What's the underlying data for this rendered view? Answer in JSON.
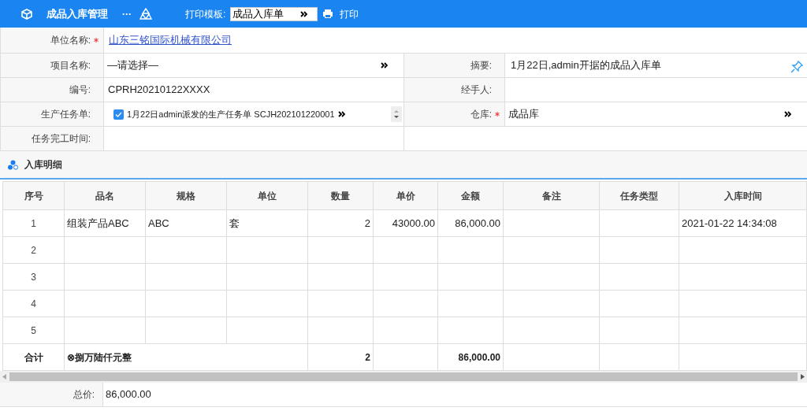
{
  "toolbar": {
    "title": "成品入库管理",
    "more": "···",
    "print_template_label": "打印模板:",
    "print_template_value": "成品入库单",
    "print_button": "打印"
  },
  "form": {
    "company": {
      "label": "单位名称:",
      "required": true,
      "value": "山东三铭国际机械有限公司"
    },
    "rows": [
      {
        "left": {
          "label": "项目名称:",
          "required": false,
          "value": "—请选择—",
          "kind": "select"
        },
        "right": {
          "label": "摘要:",
          "required": false,
          "value": "1月22日,admin开据的成品入库单",
          "kind": "pin"
        }
      },
      {
        "left": {
          "label": "编号:",
          "required": false,
          "value": "CPRH20210122XXXX",
          "kind": "text"
        },
        "right": {
          "label": "经手人:",
          "required": false,
          "kind": "text"
        }
      },
      {
        "left": {
          "label": "生产任务单:",
          "required": false,
          "value": "1月22日admin派发的生产任务单 SCJH202101220001",
          "kind": "checkselect",
          "checked": true
        },
        "right": {
          "label": "仓库:",
          "required": true,
          "value": "成品库",
          "kind": "select"
        }
      },
      {
        "left": {
          "label": "任务完工时间:",
          "required": false,
          "kind": "empty"
        }
      }
    ]
  },
  "section_title": "入库明细",
  "table": {
    "columns": [
      "序号",
      "品名",
      "规格",
      "单位",
      "数量",
      "单价",
      "金额",
      "备注",
      "任务类型",
      "入库时间"
    ],
    "rows": [
      [
        "1",
        "组装产品ABC",
        "ABC",
        "套",
        "2",
        "43000.00",
        "86,000.00",
        "",
        "",
        "2021-01-22 14:34:08"
      ],
      [
        "2",
        "",
        "",
        "",
        "",
        "",
        "",
        "",
        "",
        ""
      ],
      [
        "3",
        "",
        "",
        "",
        "",
        "",
        "",
        "",
        "",
        ""
      ],
      [
        "4",
        "",
        "",
        "",
        "",
        "",
        "",
        "",
        "",
        ""
      ],
      [
        "5",
        "",
        "",
        "",
        "",
        "",
        "",
        "",
        "",
        ""
      ]
    ],
    "total": {
      "label": "合计",
      "amount_words": "⊗捌万陆仟元整",
      "quantity": "2",
      "amount": "86,000.00"
    }
  },
  "total_price": {
    "label": "总价:",
    "value": "86,000.00"
  }
}
